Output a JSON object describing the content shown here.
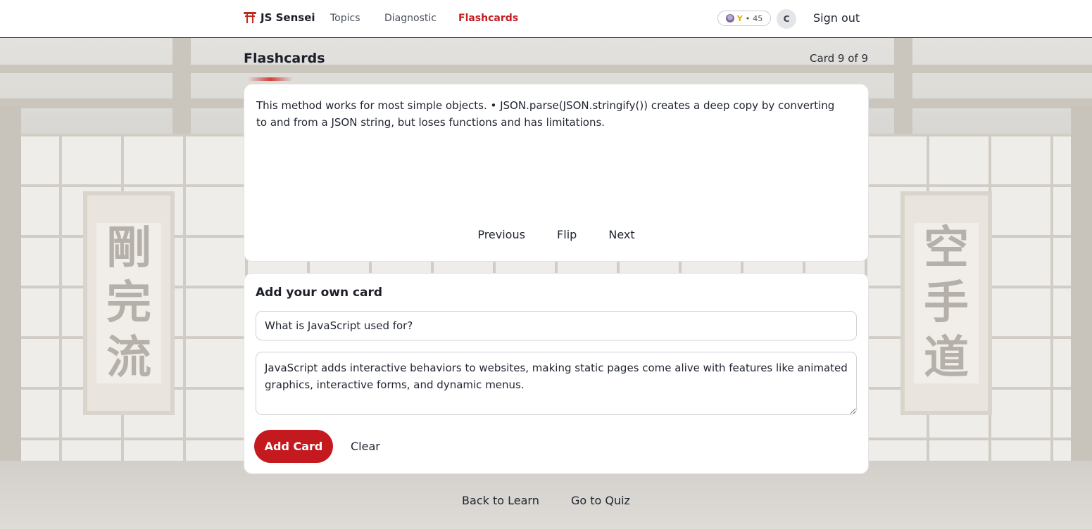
{
  "nav": {
    "brand": "JS Sensei",
    "links": [
      "Topics",
      "Diagnostic",
      "Flashcards"
    ],
    "active_link": "Flashcards",
    "belt": "Y",
    "xp_separator": "•",
    "xp": "45",
    "avatar_initial": "C",
    "signout": "Sign out"
  },
  "page": {
    "title": "Flashcards",
    "counter": "Card 9 of 9"
  },
  "flashcard": {
    "text": "This method works for most simple objects. • JSON.parse(JSON.stringify()) creates a deep copy by converting to and from a JSON string, but loses functions and has limitations.",
    "previous": "Previous",
    "flip": "Flip",
    "next": "Next"
  },
  "add_card": {
    "title": "Add your own card",
    "question_value": "What is JavaScript used for?",
    "answer_value": "JavaScript adds interactive behaviors to websites, making static pages come alive with features like animated graphics, interactive forms, and dynamic menus.",
    "add_label": "Add Card",
    "clear_label": "Clear"
  },
  "footer": {
    "back": "Back to Learn",
    "quiz": "Go to Quiz"
  },
  "background": {
    "left_scroll": [
      "剛",
      "完",
      "流"
    ],
    "right_scroll": [
      "空",
      "手",
      "道"
    ]
  },
  "colors": {
    "accent": "#c41e22",
    "belt": "#d8b100"
  }
}
